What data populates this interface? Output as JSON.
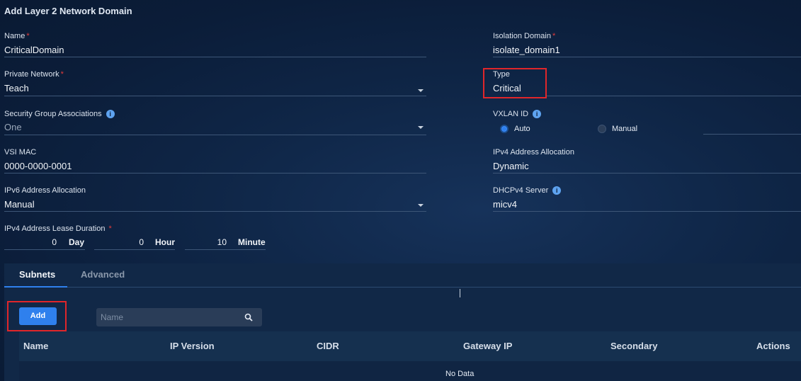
{
  "form_title": "Add Layer 2 Network Domain",
  "required_mark": "*",
  "fields": {
    "name": {
      "label": "Name",
      "value": "CriticalDomain"
    },
    "isolation_domain": {
      "label": "Isolation Domain",
      "value": "isolate_domain1"
    },
    "private_network": {
      "label": "Private Network",
      "value": "Teach"
    },
    "type": {
      "label": "Type",
      "value": "Critical"
    },
    "security_group": {
      "label": "Security Group Associations",
      "value": "One"
    },
    "vxlan_id": {
      "label": "VXLAN ID",
      "options": [
        "Auto",
        "Manual"
      ],
      "selected": "Auto"
    },
    "vsi_mac": {
      "label": "VSI MAC",
      "value": "0000-0000-0001"
    },
    "ipv4_alloc": {
      "label": "IPv4 Address Allocation",
      "value": "Dynamic"
    },
    "ipv6_alloc": {
      "label": "IPv6 Address Allocation",
      "value": "Manual"
    },
    "dhcpv4_server": {
      "label": "DHCPv4 Server",
      "value": "micv4"
    },
    "lease_duration": {
      "label": "IPv4 Address Lease Duration",
      "day": {
        "value": "0",
        "unit": "Day"
      },
      "hour": {
        "value": "0",
        "unit": "Hour"
      },
      "minute": {
        "value": "10",
        "unit": "Minute"
      }
    }
  },
  "info_glyph": "i",
  "tabs": [
    {
      "label": "Subnets",
      "active": true
    },
    {
      "label": "Advanced",
      "active": false
    }
  ],
  "subnets": {
    "add_label": "Add",
    "search_placeholder": "Name",
    "columns": [
      "Name",
      "IP Version",
      "CIDR",
      "Gateway IP",
      "Secondary",
      "Actions"
    ],
    "empty_text": "No Data"
  },
  "colors": {
    "accent": "#2f80ed",
    "required": "#e53b3b",
    "highlight_box": "#e0262a",
    "background": "#0f2647"
  }
}
